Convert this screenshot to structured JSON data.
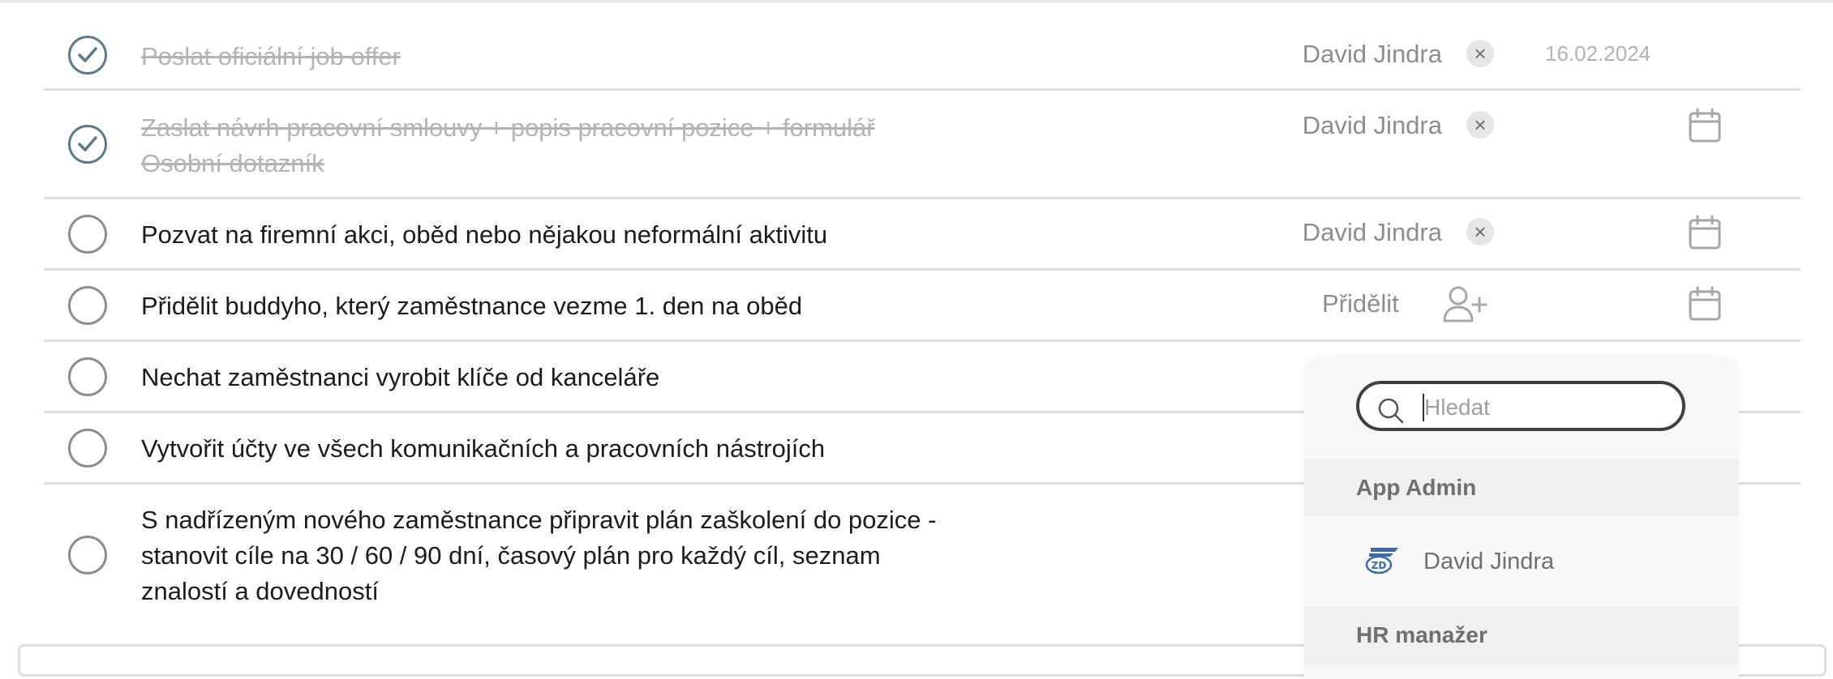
{
  "tasks": [
    {
      "title": "Poslat oficiální job offer",
      "done": true,
      "assignee": "David Jindra",
      "date": "16.02.2024"
    },
    {
      "title_line1": "Zaslat návrh pracovní smlouvy + popis pracovní pozice + formulář",
      "title_line2": "Osobní dotazník",
      "done": true,
      "assignee": "David Jindra"
    },
    {
      "title": "Pozvat na firemní akci, oběd nebo nějakou neformální aktivitu",
      "done": false,
      "assignee": "David Jindra"
    },
    {
      "title": "Přidělit buddyho, který zaměstnance vezme 1. den na oběd",
      "done": false,
      "assign_label": "Přidělit"
    },
    {
      "title": "Nechat zaměstnanci vyrobit klíče od kanceláře",
      "done": false
    },
    {
      "title": "Vytvořit účty ve všech komunikačních a pracovních nástrojích",
      "done": false
    },
    {
      "title_line1": "S nadřízeným nového zaměstnance připravit plán zaškolení do pozice -",
      "title_line2": "stanovit cíle na 30 / 60 / 90 dní, časový plán pro každý cíl, seznam",
      "title_line3": "znalostí a dovedností",
      "done": false
    }
  ],
  "dropdown": {
    "search_placeholder": "Hledat",
    "groups": [
      {
        "label": "App Admin",
        "options": [
          {
            "name": "David Jindra"
          }
        ]
      },
      {
        "label": "HR manažer"
      }
    ]
  },
  "icons": {
    "check": "checkmark-icon",
    "remove": "close-icon",
    "calendar": "calendar-icon",
    "assign": "add-user-icon",
    "search": "search-icon",
    "logo": "company-logo-icon"
  },
  "colors": {
    "done_check": "#5a7a88",
    "muted_text": "#8d8d8d",
    "done_text": "#b4b4b4"
  }
}
